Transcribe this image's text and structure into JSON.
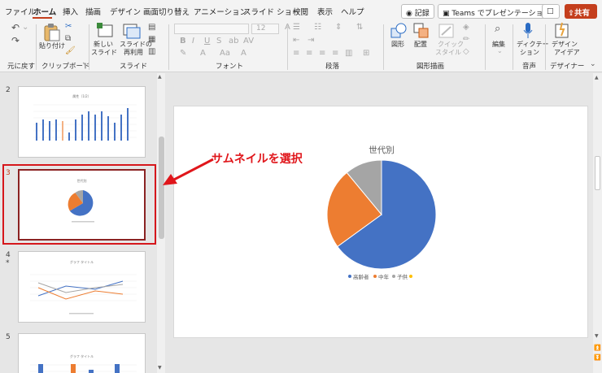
{
  "tabs": [
    "ファイル",
    "ホーム",
    "挿入",
    "描画",
    "デザイン",
    "画面切り替え",
    "アニメーション",
    "スライド ショー",
    "校閲",
    "表示",
    "ヘルプ"
  ],
  "top_buttons": {
    "record": "記録",
    "teams": "Teams でプレゼンテーション",
    "share": "共有"
  },
  "ribbon": {
    "undo_group": "元に戻す",
    "clipboard_group": "クリップボード",
    "paste": "貼り付け",
    "slides_group": "スライド",
    "new_slide_line1": "新しい",
    "new_slide_line2": "スライド",
    "reuse_line1": "スライドの",
    "reuse_line2": "再利用",
    "font_group": "フォント",
    "font_size": "12",
    "paragraph_group": "段落",
    "drawing_group": "図形描画",
    "shape": "図形",
    "arrange": "配置",
    "quick_style_line1": "クイック",
    "quick_style_line2": "スタイル",
    "edit": "編集",
    "voice_group": "音声",
    "dictate_line1": "ディクテー",
    "dictate_line2": "ション",
    "designer_group": "デザイナー",
    "design_idea_line1": "デザイン",
    "design_idea_line2": "アイデア"
  },
  "slides": [
    {
      "number": "2",
      "title": "属性（1/2）"
    },
    {
      "number": "3",
      "title": "世代別"
    },
    {
      "number": "4",
      "star": "*",
      "title": "グラフ タイトル"
    },
    {
      "number": "5",
      "title": "グラフ タイトル"
    }
  ],
  "annotation": "サムネイルを選択",
  "colors": {
    "blue": "#4472c4",
    "orange": "#ed7d31",
    "gray": "#a5a5a5",
    "yellow": "#ffc000",
    "accent": "#c43e1c",
    "annotation": "#e0161b"
  },
  "chart_data": {
    "type": "pie",
    "title": "世代別",
    "categories": [
      "高齢者",
      "中年",
      "子供",
      ""
    ],
    "values": [
      65,
      24,
      11,
      0
    ],
    "legend_position": "bottom"
  }
}
